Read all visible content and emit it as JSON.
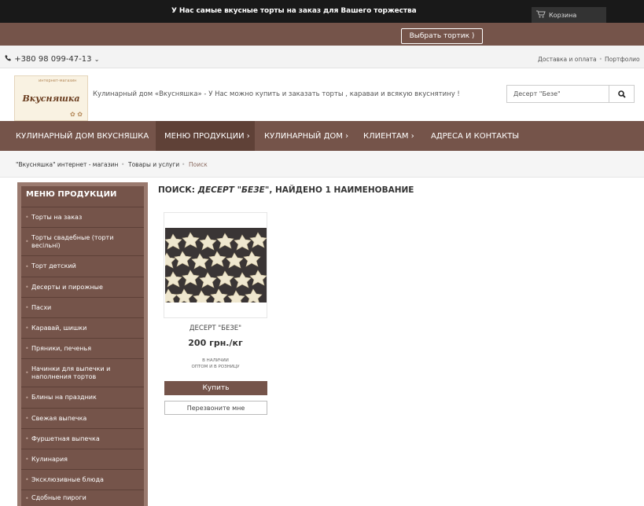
{
  "topbar": {
    "cart_label": "Корзина",
    "cart_icon": "cart-icon"
  },
  "promo": {
    "text": "У Нас самые вкусные торты на заказ для Вашего торжества",
    "button_label": "Выбрать тортик )"
  },
  "contact": {
    "phone": "+380 98 099-47-13",
    "links": [
      "Доставка и оплата",
      "Портфолио"
    ]
  },
  "header": {
    "logo_top": "интернет-магазин",
    "logo_text": "Вкусняшка",
    "tagline": "Кулинарный дом «Вкусняшка» - У Нас можно купить и заказать торты , караваи и всякую вкуснятину !",
    "search_value": "Десерт \"Безе\"",
    "search_icon": "search-icon"
  },
  "nav": {
    "items": [
      {
        "label": "КУЛИНАРНЫЙ ДОМ ВКУСНЯШКА"
      },
      {
        "label": "МЕНЮ ПРОДУКЦИИ ›"
      },
      {
        "label": "КУЛИНАРНЫЙ ДОМ ›"
      },
      {
        "label": "КЛИЕНТАМ ›"
      },
      {
        "label": "АДРЕСА И КОНТАКТЫ"
      }
    ]
  },
  "breadcrumbs": [
    "\"Вкусняшка\" интернет - магазин",
    "Товары и услуги",
    "Поиск"
  ],
  "sidebar": {
    "title": "МЕНЮ ПРОДУКЦИИ",
    "items": [
      "Торты на заказ",
      "Торты свадебные (торти весільні)",
      "Торт детский",
      "Десерты и пирожные",
      "Пасхи",
      "Каравай, шишки",
      "Пряники, печенья",
      "Начинки для выпечки и наполнения тортов",
      "Блины на праздник",
      "Свежая выпечка",
      "Фуршетная выпечка",
      "Кулинария",
      "Эксклюзивные блюда",
      "Сдобные пироги"
    ]
  },
  "main": {
    "title_prefix": "ПОИСК: ",
    "title_query": "ДЕСЕРТ \"БЕЗЕ\"",
    "title_suffix": ", НАЙДЕНО 1 НАИМЕНОВАНИЕ",
    "product": {
      "name": "ДЕСЕРТ \"БЕЗЕ\"",
      "price": "200 грн./кг",
      "stock_line1": "В НАЛИЧИИ",
      "stock_line2": "ОПТОМ И В РОЗНИЦУ",
      "buy_label": "Купить",
      "call_label": "Перезвоните мне"
    }
  },
  "colors": {
    "brand": "#75544a",
    "brand_dark": "#5f4137",
    "topbar": "#191919"
  }
}
